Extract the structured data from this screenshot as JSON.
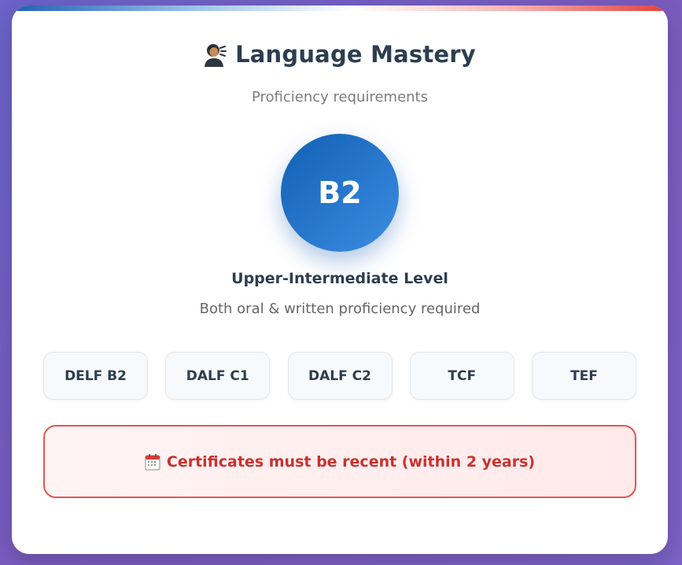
{
  "header": {
    "icon": "speaking-person-icon",
    "title": "Language Mastery",
    "subtitle": "Proficiency requirements"
  },
  "level": {
    "code": "B2",
    "name": "Upper-Intermediate Level",
    "description": "Both oral & written proficiency required"
  },
  "certificates": [
    {
      "label": "DELF B2"
    },
    {
      "label": "DALF C1"
    },
    {
      "label": "DALF C2"
    },
    {
      "label": "TCF"
    },
    {
      "label": "TEF"
    }
  ],
  "notice": {
    "icon": "calendar-icon",
    "text": "Certificates must be recent (within 2 years)"
  },
  "colors": {
    "accent_blue": "#1f66bd",
    "title_text": "#2c3e50",
    "alert_red": "#c8322f",
    "alert_border": "#e35652",
    "background": "#7060c6"
  }
}
